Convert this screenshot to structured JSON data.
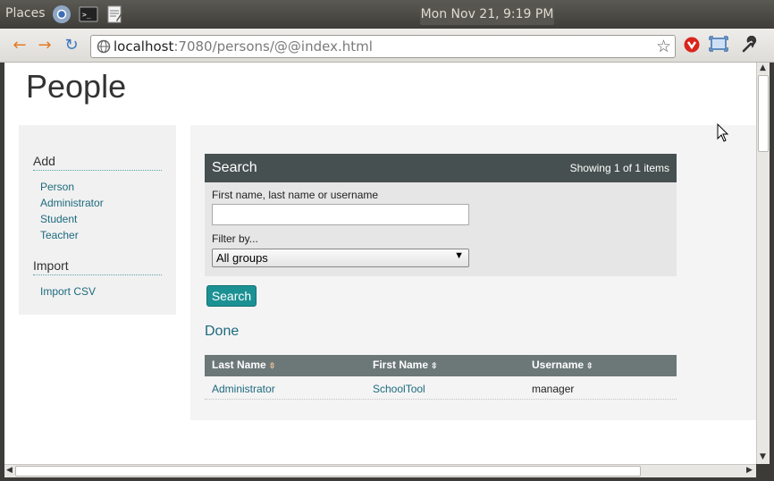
{
  "panel": {
    "places_label": "Places",
    "clock": "Mon Nov 21,  9:19 PM"
  },
  "browser": {
    "url_host": "localhost",
    "url_rest": ":7080/persons/@@index.html"
  },
  "page": {
    "title": "People"
  },
  "sidebar": {
    "add_heading": "Add",
    "add_links": [
      "Person",
      "Administrator",
      "Student",
      "Teacher"
    ],
    "import_heading": "Import",
    "import_links": [
      "Import CSV"
    ]
  },
  "search": {
    "title": "Search",
    "count_text": "Showing 1 of 1 items",
    "query_label": "First name, last name or username",
    "query_value": "",
    "filter_label": "Filter by...",
    "filter_value": "All groups",
    "button_label": "Search"
  },
  "done_label": "Done",
  "table": {
    "headers": [
      "Last Name",
      "First Name",
      "Username"
    ],
    "rows": [
      {
        "last_name": "Administrator",
        "first_name": "SchoolTool",
        "username": "manager"
      }
    ]
  },
  "colors": {
    "accent": "#1c9194",
    "link": "#1d6a7e",
    "header_dark": "#475050",
    "table_header": "#6c7777"
  }
}
